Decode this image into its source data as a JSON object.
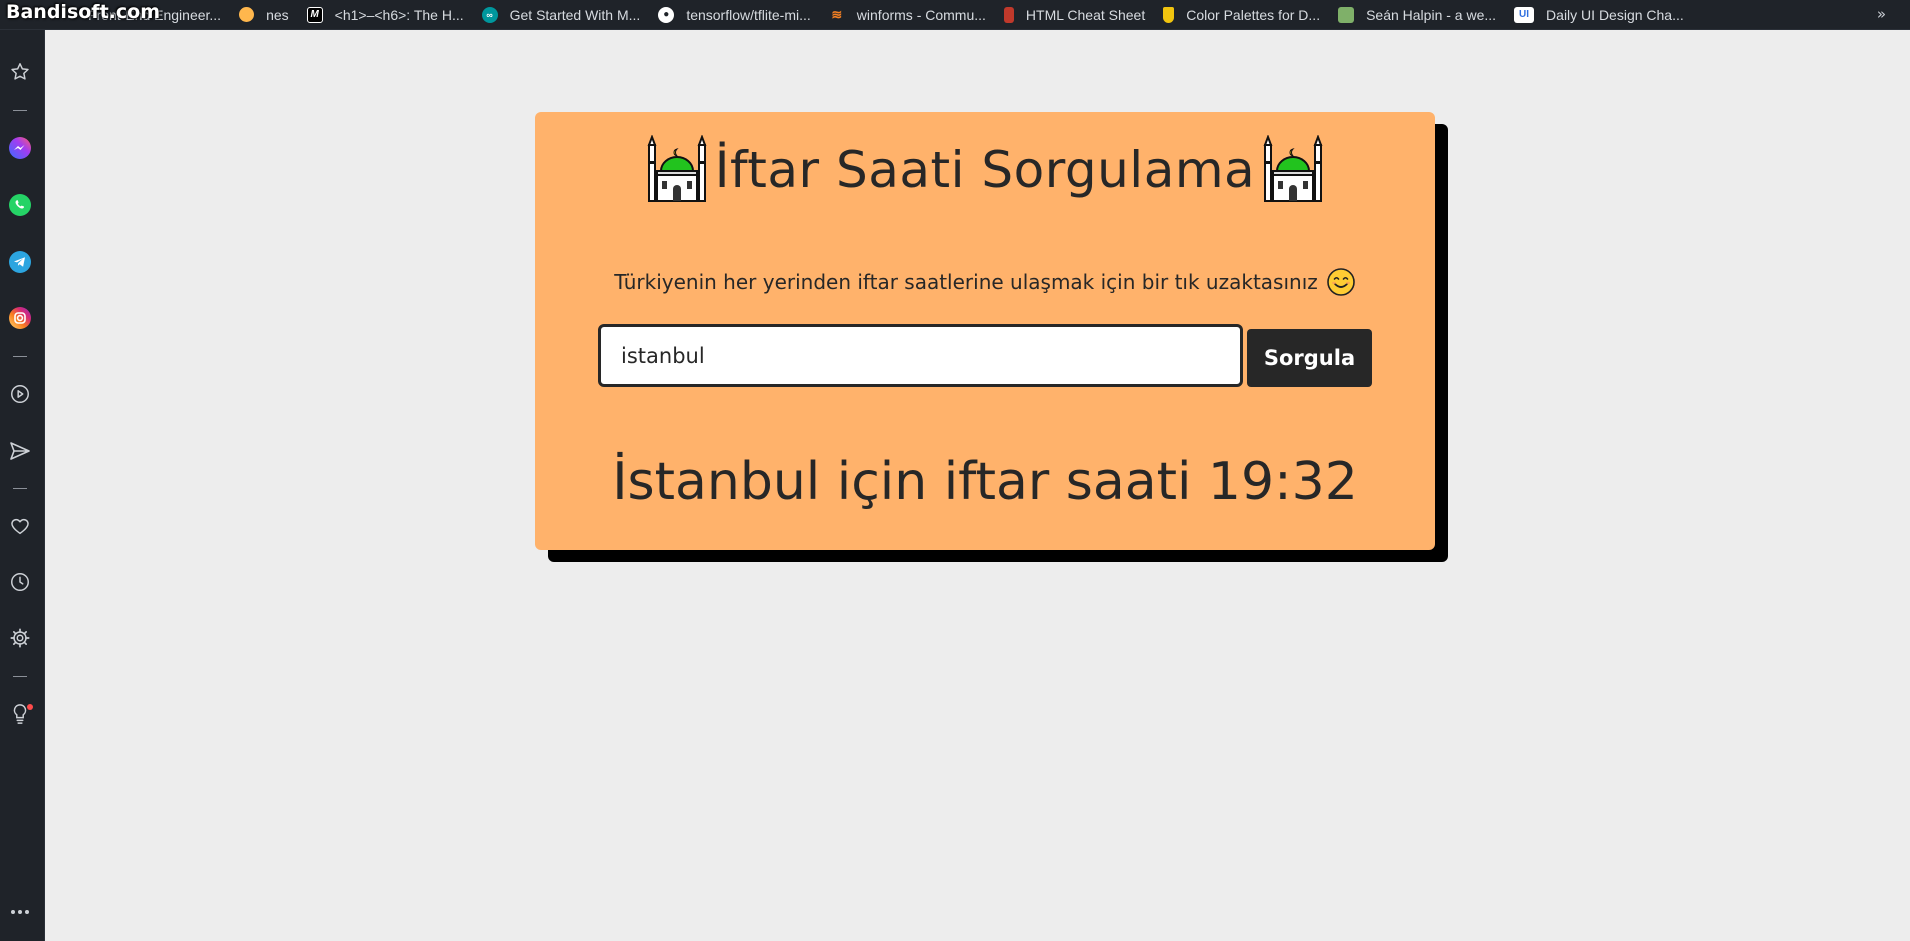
{
  "watermark": "Bandisoft.com",
  "bookmarks": [
    {
      "label": "Front-End Engineer...",
      "icon": "bookmark-icon",
      "color": "#3b82f6"
    },
    {
      "label": "nes",
      "icon": "orange-circle-icon",
      "color": "#ffb74d"
    },
    {
      "label": "<h1>–<h6>: The H...",
      "icon": "mdn-icon",
      "color": "#000000"
    },
    {
      "label": "Get Started With M...",
      "icon": "arduino-icon",
      "color": "#00979d"
    },
    {
      "label": "tensorflow/tflite-mi...",
      "icon": "github-icon",
      "color": "#ffffff"
    },
    {
      "label": "winforms - Commu...",
      "icon": "stackoverflow-icon",
      "color": "#f48024"
    },
    {
      "label": "HTML Cheat Sheet",
      "icon": "html-icon",
      "color": "#c0392b"
    },
    {
      "label": "Color Palettes for D...",
      "icon": "palette-icon",
      "color": "#f1c40f"
    },
    {
      "label": "Seán Halpin - a we...",
      "icon": "avatar-icon",
      "color": "#7fb069"
    },
    {
      "label": "Daily UI Design Cha...",
      "icon": "ui-icon",
      "color": "#2f6fdf"
    }
  ],
  "app": {
    "title": "İftar Saati Sorgulama",
    "subtitle": "Türkiyenin her yerinden iftar saatlerine ulaşmak için bir tık uzaktasınız",
    "search": {
      "value": "istanbul",
      "button_label": "Sorgula"
    },
    "result": "İstanbul için iftar saati 19:32"
  },
  "colors": {
    "card": "#ffb26b",
    "text": "#272727",
    "background": "#ededed",
    "sidebar": "#1f2329"
  }
}
